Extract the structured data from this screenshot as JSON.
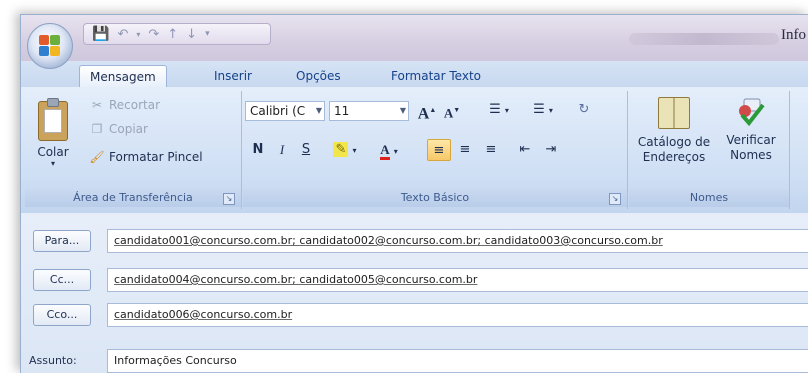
{
  "window": {
    "title_partial": "Info"
  },
  "tabs": [
    "Mensagem",
    "Inserir",
    "Opções",
    "Formatar Texto"
  ],
  "clipboard": {
    "paste": "Colar",
    "cut": "Recortar",
    "copy": "Copiar",
    "format_painter": "Formatar Pincel",
    "group_label": "Área de Transferência"
  },
  "basic_text": {
    "font_name": "Calibri (C",
    "font_size": "11",
    "bold": "N",
    "italic": "I",
    "underline": "S",
    "grow": "A",
    "shrink": "A",
    "font_color": "A",
    "group_label": "Texto Básico"
  },
  "names": {
    "address_book": "Catálogo de Endereços",
    "check_names": "Verificar Nomes",
    "group_label": "Nomes"
  },
  "address": {
    "to_button": "Para...",
    "to_value": "candidato001@concurso.com.br; candidato002@concurso.com.br; candidato003@concurso.com.br",
    "cc_button": "Cc...",
    "cc_value": "candidato004@concurso.com.br; candidato005@concurso.com.br",
    "bcc_button": "Cco...",
    "bcc_value": "candidato006@concurso.com.br",
    "subject_label": "Assunto:",
    "subject_value": "Informações Concurso"
  },
  "icons": [
    "office-button-icon",
    "save-icon",
    "undo-icon",
    "redo-icon",
    "paste-icon",
    "cut-icon",
    "copy-icon",
    "format-painter-icon",
    "bullets-icon",
    "numbering-icon",
    "highlight-icon",
    "address-book-icon",
    "check-names-icon"
  ]
}
